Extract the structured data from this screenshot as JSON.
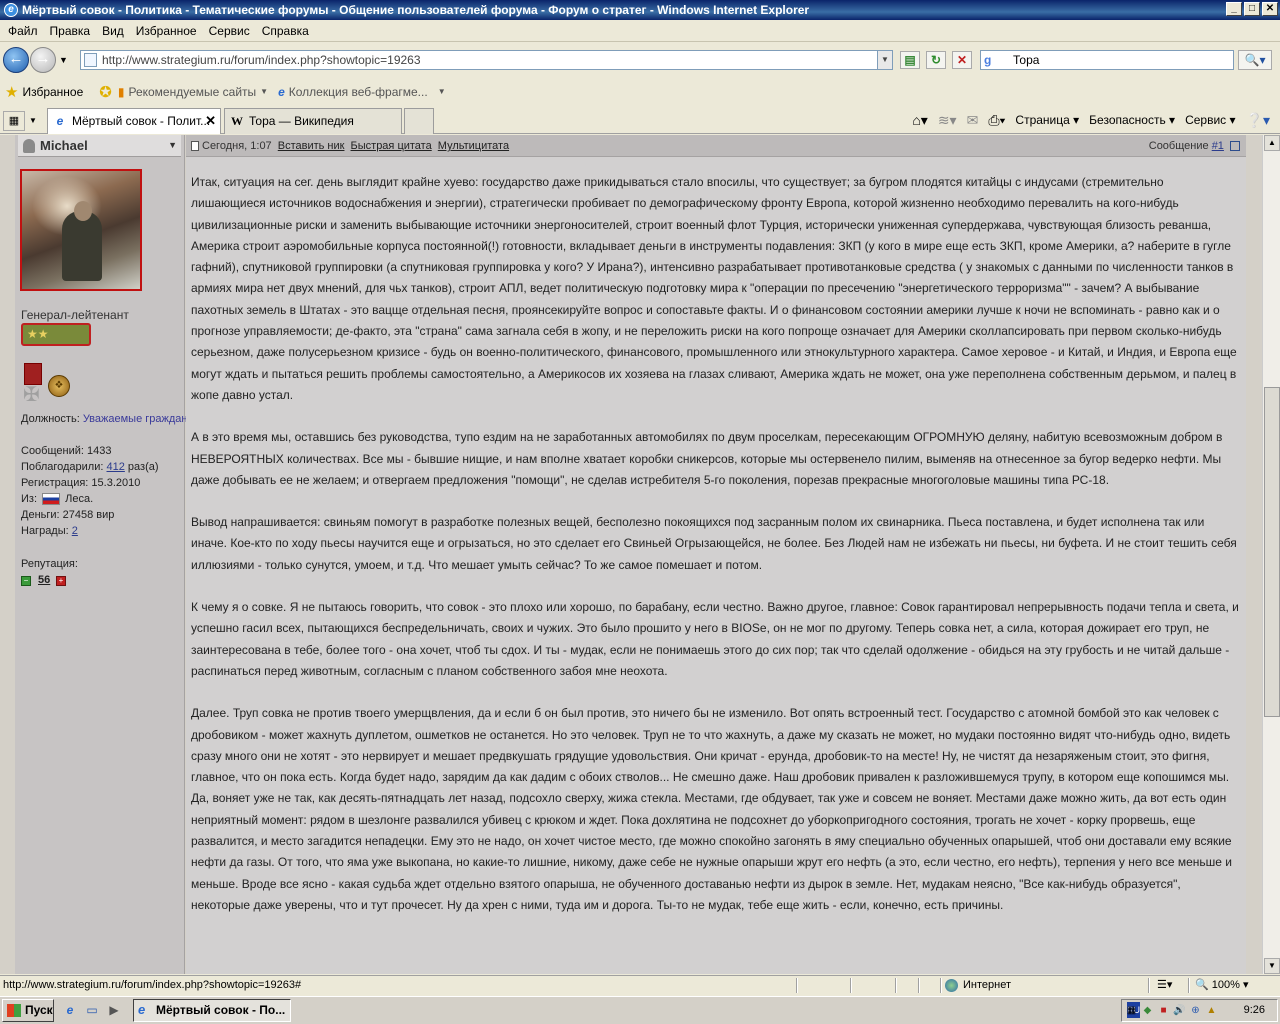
{
  "window": {
    "title": "Мёртвый совок - Политика - Тематические форумы - Общение пользователей форума - Форум о стратег - Windows Internet Explorer",
    "buttons": [
      "_",
      "□",
      "✕"
    ]
  },
  "menubar": [
    "Файл",
    "Правка",
    "Вид",
    "Избранное",
    "Сервис",
    "Справка"
  ],
  "address": {
    "url": "http://www.strategium.ru/forum/index.php?showtopic=19263",
    "search_value": "Тора"
  },
  "favorites": {
    "label": "Избранное",
    "items": [
      "Рекомендуемые сайты",
      "Коллекция веб-фрагме..."
    ]
  },
  "tabs": [
    {
      "label": "Мёртвый совок - Полит...",
      "active": true
    },
    {
      "label": "Тора — Википедия",
      "active": false
    }
  ],
  "commandbar": {
    "page": "Страница",
    "safety": "Безопасность",
    "tools": "Сервис"
  },
  "post": {
    "username": "Michael",
    "rank": "Генерал-лейтенант",
    "rank_stars": "★★",
    "profile": {
      "role_label": "Должность:",
      "role_value": "Уважаемые граждани",
      "messages": "Сообщений: 1433",
      "thanks_label": "Поблагодарили:",
      "thanks_count": "412",
      "thanks_suffix": "раз(а)",
      "registered": "Регистрация: 15.3.2010",
      "from_label": "Из:",
      "from_value": "Леса.",
      "money": "Деньги: 27458 вир",
      "awards_label": "Награды:",
      "awards_count": "2",
      "reputation_label": "Репутация:",
      "reputation_value": "56"
    },
    "header": {
      "date": "Сегодня, 1:07",
      "insert_nick": "Вставить ник",
      "quick_quote": "Быстрая цитата",
      "multiquote": "Мультицитата",
      "message_label": "Сообщение",
      "message_num": "#1"
    },
    "paragraphs": [
      "Итак, ситуация на сег. день выглядит крайне хуево: государство даже прикидываться стало впосилы, что существует; за бугром плодятся китайцы с индусами (стремительно лишающиеся источников водоснабжения и энергии), стратегически пробивает по демографическому фронту Европа, которой жизненно необходимо перевалить на кого-нибудь цивилизационные риски и заменить выбывающие источники энергоносителей, строит военный флот Турция, исторически униженная супердержава, чувствующая близость реванша, Америка строит аэромобильные корпуса постоянной(!) готовности, вкладывает деньги в инструменты подавления: ЗКП (у кого в мире еще есть ЗКП, кроме Америки, а? наберите в гугле гафний), спутниковой группировки (а спутниковая группировка у кого? У Ирана?), интенсивно разрабатывает противотанковые средства ( у знакомых с данными по численности танков в армиях мира нет двух мнений, для чьх танков), строит АПЛ, ведет политическую подготовку мира к \"операции по пресечению \"энергетического терроризма\"\" - зачем? А выбывание пахотных земель в Штатах - это вацще отдельная песня, проянсекируйте вопрос и сопоставьте факты. И о финансовом состоянии америки лучше к ночи не вспоминать - равно как и о прогнозе управляемости; де-факто, эта \"страна\" сама загнала себя в жопу, и не переложить риски на кого попроще означает для Америки сколлапсировать при первом сколько-нибудь серьезном, даже полусерьезном кризисе - будь он военно-политического, финансового, промышленного или этнокультурного характера. Самое херовое - и Китай, и Индия, и Европа еще могут ждать и пытаться решить проблемы самостоятельно, а Америкосов их хозяева на глазах сливают, Америка ждать не может, она уже переполнена собственным дерьмом, и палец в жопе давно устал.",
      "А в это время мы, оставшись без руководства, тупо ездим на не заработанных автомобилях по двум проселкам, пересекающим ОГРОМНУЮ деляну, набитую всевозможным добром в НЕВЕРОЯТНЫХ количествах. Все мы - бывшие нищие, и нам вполне хватает коробки сникерсов, которые мы остервенело пилим, выменяв на отнесенное за бугор ведерко нефти. Мы даже добывать ее не желаем; и отвергаем предложения \"помощи\", не сделав истребителя 5-го поколения, порезав прекрасные многоголовые машины типа РС-18.",
      "Вывод напрашивается: свиньям помогут в разработке полезных вещей, бесполезно покоящихся под засранным полом их свинарника. Пьеса поставлена, и будет исполнена так или иначе. Кое-кто по ходу пьесы научится еще и огрызаться, но это сделает его Свиньей Огрызающейся, не более. Без Людей нам не избежать ни пьесы, ни буфета. И не стоит тешить себя иллюзиями - только сунутся, умоем, и т.д. Что мешает умыть сейчас? То же самое помешает и потом.",
      "К чему я о совке. Я не пытаюсь говорить, что совок - это плохо или хорошо, по барабану, если честно. Важно другое, главное: Совок гарантировал непрерывность подачи тепла и света, и успешно гасил всех, пытающихся беспредельничать, своих и чужих. Это было прошито у него в BIOSе, он не мог по другому. Теперь совка нет, а сила, которая дожирает его труп, не заинтересована в тебе, более того - она хочет, чтоб ты сдох. И ты - мудак, если не понимаешь этого до сих пор; так что сделай одолжение - обидься на эту грубость и не читай дальше - распинаться перед животным, согласным с планом собственного забоя мне неохота.",
      "Далее. Труп совка не против твоего умерщвления, да и если б он был против, это ничего бы не изменило. Вот опять встроенный тест. Государство с атомной бомбой это как человек с дробовиком - может жахнуть дуплетом, ошметков не останется. Но это человек. Труп не то что жахнуть, а даже му сказать не может, но мудаки постоянно видят что-нибудь одно, видеть сразу много они не хотят - это нервирует и мешает предвкушать грядущие удовольствия. Они кричат - ерунда, дробовик-то на месте! Ну, не чистят да незаряженым стоит, это фигня, главное, что он пока есть. Когда будет надо, зарядим да как дадим с обоих стволов... Не смешно даже. Наш дробовик привален к разложившемуся трупу, в котором еще копошимся мы. Да, воняет уже не так, как десять-пятнадцать лет назад, подсохло сверху, жижа стекла. Местами, где обдувает, так уже и совсем не воняет. Местами даже можно жить, да вот есть один неприятный момент: рядом в шезлонге развалился убивец с крюком и ждет. Пока дохлятина не подсохнет до уборкопригодного состояния, трогать не хочет - корку прорвешь, еще развалится, и место загадится непадецки. Ему это не надо, он хочет чистое место, где можно спокойно загонять в яму специально обученных опарышей, чтоб они доставали ему всякие нефти да газы. От того, что яма уже выкопана, но какие-то лишние, никому, даже себе не нужные опарыши жрут его нефть (а это, если честно, его нефть), терпения у него все меньше и меньше. Вроде все ясно - какая судьба ждет отдельно взятого опарыша, не обученного доставанью нефти из дырок в земле. Нет, мудакам неясно, \"Все как-нибудь образуется\", некоторые даже уверены, что и тут прочесет. Ну да хрен с ними, туда им и дорога. Ты-то не мудак, тебе еще жить - если, конечно, есть причины."
    ]
  },
  "statusbar": {
    "url": "http://www.strategium.ru/forum/index.php?showtopic=19263#",
    "zone": "Интернет",
    "zoom": "100%"
  },
  "taskbar": {
    "start": "Пуск",
    "task": "Мёртвый совок - По...",
    "lang": "RU",
    "clock": "9:26"
  }
}
